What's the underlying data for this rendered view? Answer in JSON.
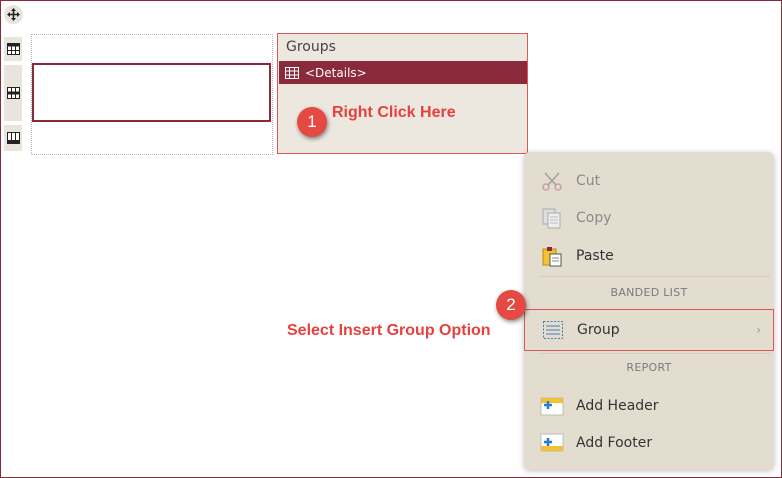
{
  "designer": {
    "groups_title": "Groups",
    "details_label": "<Details>"
  },
  "annotations": {
    "step1_number": "1",
    "step1_text": "Right Click Here",
    "step2_number": "2",
    "step2_text": "Select Insert Group Option"
  },
  "context_menu": {
    "items": [
      {
        "label": "Cut",
        "icon": "scissors-icon",
        "enabled": false
      },
      {
        "label": "Copy",
        "icon": "copy-icon",
        "enabled": false
      },
      {
        "label": "Paste",
        "icon": "paste-icon",
        "enabled": true
      }
    ],
    "section_banded": "BANDED LIST",
    "group_label": "Group",
    "section_report": "REPORT",
    "report_items": [
      {
        "label": "Add Header",
        "icon": "add-header-icon"
      },
      {
        "label": "Add Footer",
        "icon": "add-footer-icon"
      }
    ]
  },
  "colors": {
    "accent": "#8b2a3a",
    "callout": "#e8403e",
    "menu_bg": "#e3ddd0",
    "panel_bg": "#ece8df"
  }
}
